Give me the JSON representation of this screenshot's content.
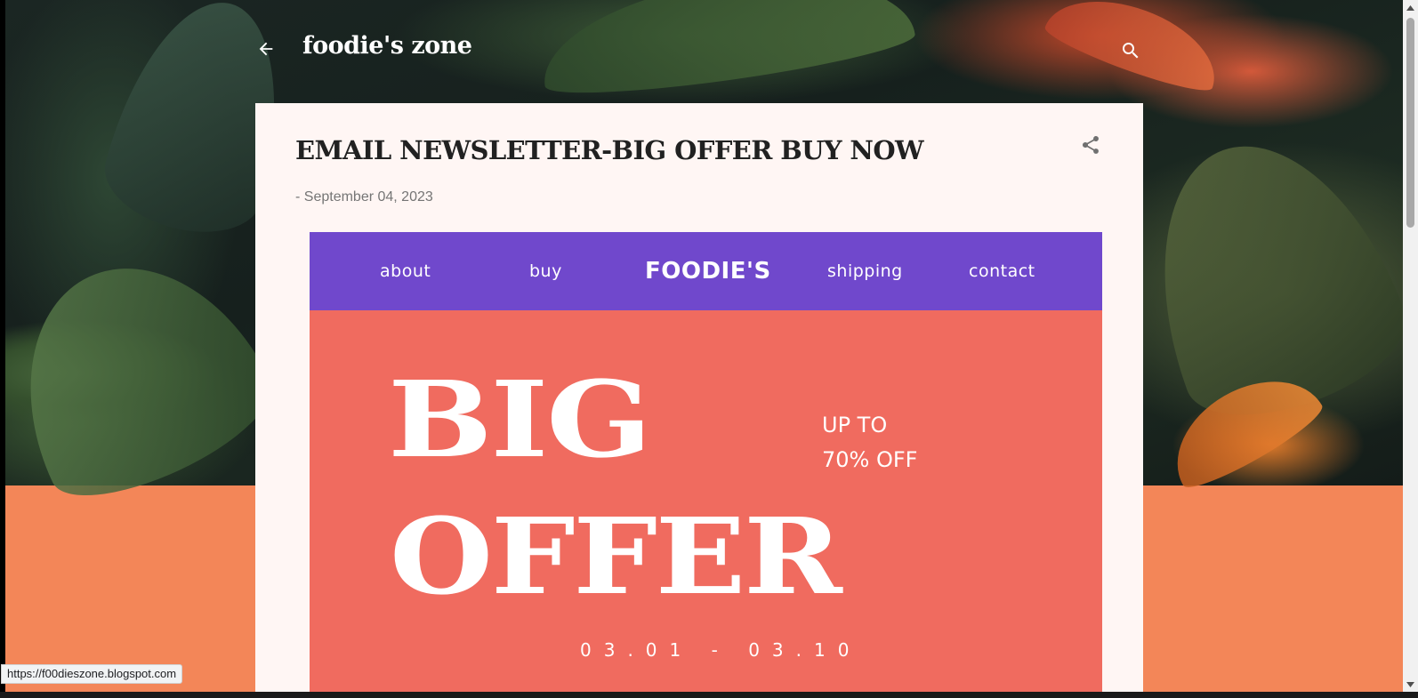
{
  "blog": {
    "title": "foodie's zone",
    "back_icon": "arrow-back-icon",
    "search_icon": "search-icon"
  },
  "post": {
    "title": "EMAIL NEWSLETTER-BIG OFFER BUY NOW",
    "date": "- September 04, 2023",
    "share_icon": "share-icon"
  },
  "newsletter": {
    "nav": {
      "about": "about",
      "buy": "buy",
      "brand": "FOODIE'S",
      "shipping": "shipping",
      "contact": "contact"
    },
    "big_word_1": "BIG",
    "big_word_2": "OFFER",
    "offer_line_1": "UP TO",
    "offer_line_2": "70% OFF",
    "dates": "03.01 - 03.10",
    "colors": {
      "nav_bg": "#7048cc",
      "body_bg": "#f06b5f"
    }
  },
  "status_bar": {
    "url": "https://f00dieszone.blogspot.com"
  },
  "colors": {
    "page_accent": "#f38658",
    "card_bg": "#fff6f4"
  }
}
